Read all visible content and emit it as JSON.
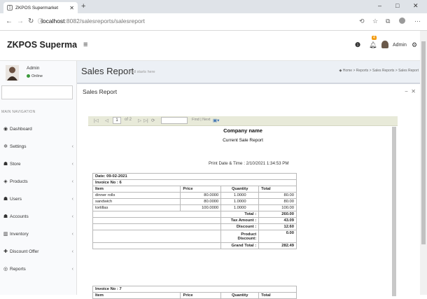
{
  "browser": {
    "tab_title": "ZKPOS Supermarket",
    "url_host": "localhost",
    "url_path": ":8082/salesreports/salesreport",
    "window_controls": [
      "–",
      "□",
      "✕"
    ]
  },
  "header": {
    "brand": "ZKPOS Supermarket",
    "notification_count": "4",
    "user_name": "Admin"
  },
  "sidebar": {
    "user_name": "Admin",
    "user_status": "Online",
    "nav_header": "MAIN NAVIGATION",
    "items": [
      {
        "label": "Dashboard",
        "icon": "dashboard-icon",
        "glyph": "◉",
        "has_children": false
      },
      {
        "label": "Settings",
        "icon": "gear-icon",
        "glyph": "✲",
        "has_children": true
      },
      {
        "label": "Store",
        "icon": "users-icon",
        "glyph": "☗",
        "has_children": true
      },
      {
        "label": "Products",
        "icon": "cube-icon",
        "glyph": "◈",
        "has_children": true
      },
      {
        "label": "Users",
        "icon": "users-icon",
        "glyph": "☗",
        "has_children": true
      },
      {
        "label": "Accounts",
        "icon": "users-icon",
        "glyph": "☗",
        "has_children": true
      },
      {
        "label": "Inventory",
        "icon": "bar-chart-icon",
        "glyph": "▥",
        "has_children": true
      },
      {
        "label": "Discount Offer",
        "icon": "plus-icon",
        "glyph": "✚",
        "has_children": true
      },
      {
        "label": "Reports",
        "icon": "eye-icon",
        "glyph": "◎",
        "has_children": true
      }
    ]
  },
  "page": {
    "title": "Sales Report",
    "subtitle": "It all starts here",
    "breadcrumb": "Home  >  Reports  >  Sales Reports  >  Sales Report",
    "box_title": "Sales Report"
  },
  "report_toolbar": {
    "page_current": "1",
    "page_total": "of 2",
    "find_label": "Find | Next"
  },
  "report": {
    "company": "Company name",
    "report_title": "Current Sale Report",
    "print_date": "Print Date & Time : 2/10/2021 1:34:53 PM",
    "date_line": "Date: 09-02-2021",
    "invoices": [
      {
        "label": "Invoice No : 6",
        "columns": [
          "Item",
          "Price",
          "Quantity",
          "Total"
        ],
        "rows": [
          {
            "item": "dinner rolls",
            "price": "80.0000",
            "qty": "1.0000",
            "total": "80.00"
          },
          {
            "item": "sandwich",
            "price": "80.0000",
            "qty": "1.0000",
            "total": "80.00"
          },
          {
            "item": "tortillas",
            "price": "100.0000",
            "qty": "1.0000",
            "total": "100.00"
          }
        ],
        "summary": [
          {
            "label": "Total :",
            "value": "260.00"
          },
          {
            "label": "Tax Amount :",
            "value": "43.09"
          },
          {
            "label": "Discount :",
            "value": "12.60"
          },
          {
            "label": "Product Discount:",
            "value": "0.00"
          },
          {
            "label": "Grand Total :",
            "value": "282.49"
          }
        ]
      },
      {
        "label": "Invoice No : 7",
        "columns": [
          "Item",
          "Price",
          "Quantity",
          "Total"
        ]
      }
    ]
  }
}
